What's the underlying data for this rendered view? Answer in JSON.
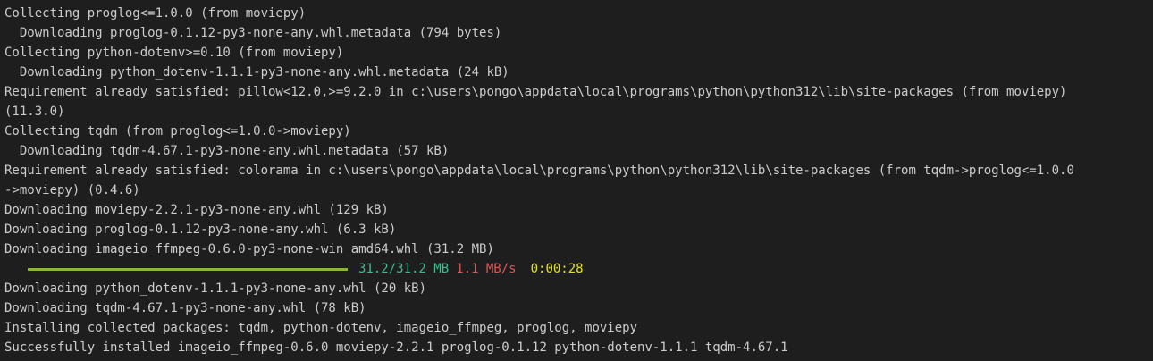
{
  "terminal": {
    "lines_before": [
      "Collecting proglog<=1.0.0 (from moviepy)",
      "  Downloading proglog-0.1.12-py3-none-any.whl.metadata (794 bytes)",
      "Collecting python-dotenv>=0.10 (from moviepy)",
      "  Downloading python_dotenv-1.1.1-py3-none-any.whl.metadata (24 kB)",
      "Requirement already satisfied: pillow<12.0,>=9.2.0 in c:\\users\\pongo\\appdata\\local\\programs\\python\\python312\\lib\\site-packages (from moviepy)",
      "(11.3.0)",
      "Collecting tqdm (from proglog<=1.0.0->moviepy)",
      "  Downloading tqdm-4.67.1-py3-none-any.whl.metadata (57 kB)",
      "Requirement already satisfied: colorama in c:\\users\\pongo\\appdata\\local\\programs\\python\\python312\\lib\\site-packages (from tqdm->proglog<=1.0.0",
      "->moviepy) (0.4.6)",
      "Downloading moviepy-2.2.1-py3-none-any.whl (129 kB)",
      "Downloading proglog-0.1.12-py3-none-any.whl (6.3 kB)",
      "Downloading imageio_ffmpeg-0.6.0-py3-none-win_amd64.whl (31.2 MB)"
    ],
    "progress": {
      "fraction": 1.0,
      "size_text": "31.2/31.2 MB",
      "rate_text": "1.1 MB/s",
      "eta_text": "0:00:28",
      "bar_color": "#8ab833",
      "size_color": "#3fbc8e",
      "rate_color": "#e05555",
      "eta_color": "#e5e510"
    },
    "lines_after": [
      "Downloading python_dotenv-1.1.1-py3-none-any.whl (20 kB)",
      "Downloading tqdm-4.67.1-py3-none-any.whl (78 kB)",
      "Installing collected packages: tqdm, python-dotenv, imageio_ffmpeg, proglog, moviepy",
      "Successfully installed imageio_ffmpeg-0.6.0 moviepy-2.2.1 proglog-0.1.12 python-dotenv-1.1.1 tqdm-4.67.1"
    ],
    "background": "#1e1e1e",
    "foreground": "#cccccc"
  }
}
